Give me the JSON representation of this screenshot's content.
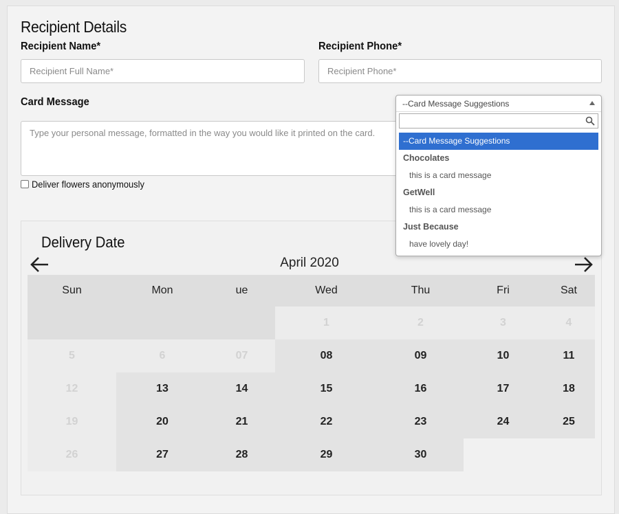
{
  "recipient": {
    "section_title": "Recipient Details",
    "name_label": "Recipient Name*",
    "name_placeholder": "Recipient Full Name*",
    "phone_label": "Recipient Phone*",
    "phone_placeholder": "Recipient Phone*"
  },
  "card": {
    "label": "Card Message",
    "message_placeholder": "Type your personal message, formatted in the way you would like it printed on the card.",
    "anonymous_label": "Deliver flowers anonymously"
  },
  "suggestions": {
    "selected": "--Card Message Suggestions",
    "search_value": "",
    "options": [
      {
        "type": "option",
        "label": "--Card Message Suggestions",
        "highlighted": true
      },
      {
        "type": "group",
        "label": "Chocolates"
      },
      {
        "type": "child",
        "label": "this is a card message"
      },
      {
        "type": "group",
        "label": "GetWell"
      },
      {
        "type": "child",
        "label": "this is a card message"
      },
      {
        "type": "group",
        "label": "Just Because"
      },
      {
        "type": "child",
        "label": "have lovely day!"
      }
    ]
  },
  "calendar": {
    "title": "Delivery Date",
    "month": "April 2020",
    "weekdays": [
      "Sun",
      "Mon",
      "ue",
      "Wed",
      "Thu",
      "Fri",
      "Sat"
    ],
    "weeks": [
      [
        null,
        null,
        null,
        {
          "d": "1",
          "muted": true
        },
        {
          "d": "2",
          "muted": true
        },
        {
          "d": "3",
          "muted": true
        },
        {
          "d": "4",
          "muted": true
        }
      ],
      [
        {
          "d": "5",
          "muted": true
        },
        {
          "d": "6",
          "muted": true
        },
        {
          "d": "07",
          "muted": true
        },
        {
          "d": "08"
        },
        {
          "d": "09"
        },
        {
          "d": "10"
        },
        {
          "d": "11"
        }
      ],
      [
        {
          "d": "12",
          "muted": true
        },
        {
          "d": "13"
        },
        {
          "d": "14"
        },
        {
          "d": "15"
        },
        {
          "d": "16"
        },
        {
          "d": "17"
        },
        {
          "d": "18"
        }
      ],
      [
        {
          "d": "19",
          "muted": true
        },
        {
          "d": "20"
        },
        {
          "d": "21"
        },
        {
          "d": "22"
        },
        {
          "d": "23"
        },
        {
          "d": "24"
        },
        {
          "d": "25"
        }
      ],
      [
        {
          "d": "26",
          "muted": true
        },
        {
          "d": "27"
        },
        {
          "d": "28"
        },
        {
          "d": "29"
        },
        {
          "d": "30"
        },
        null,
        null
      ]
    ]
  },
  "colors": {
    "highlight": "#2f6fd0",
    "cell_enabled": "#e3e3e3",
    "cell_light": "#ececec",
    "header_bg": "#dedede",
    "muted_text": "#d2d2d2"
  }
}
